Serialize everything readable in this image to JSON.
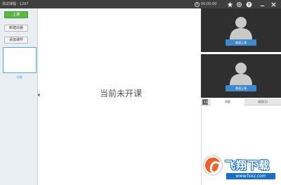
{
  "titlebar": {
    "title": "测试课程 · 1297",
    "timer": "00:00:00",
    "icons": [
      "clock-icon",
      "star-icon",
      "gear-icon",
      "help-icon",
      "minimize-icon",
      "close-icon"
    ]
  },
  "sidebar": {
    "start_label": "上课",
    "new_board_label": "新建白板",
    "add_course_label": "添加课件",
    "thumbnail_label": "白板"
  },
  "main": {
    "status_message": "当前未开课"
  },
  "video": {
    "teacher_button": "邀请上课",
    "student_button": "邀请上课"
  },
  "tabs": {
    "messages": "消息",
    "members": "成员(1)"
  },
  "watermark": {
    "text": "飞翔下载",
    "sub": "www.fxxz.com"
  },
  "colors": {
    "titlebar": "#3f3f3f",
    "start_button": "#5db545",
    "accent_blue": "#3f88cc",
    "video_bg": "#2f2f2f",
    "sidebar_bg": "#e9eef3"
  }
}
